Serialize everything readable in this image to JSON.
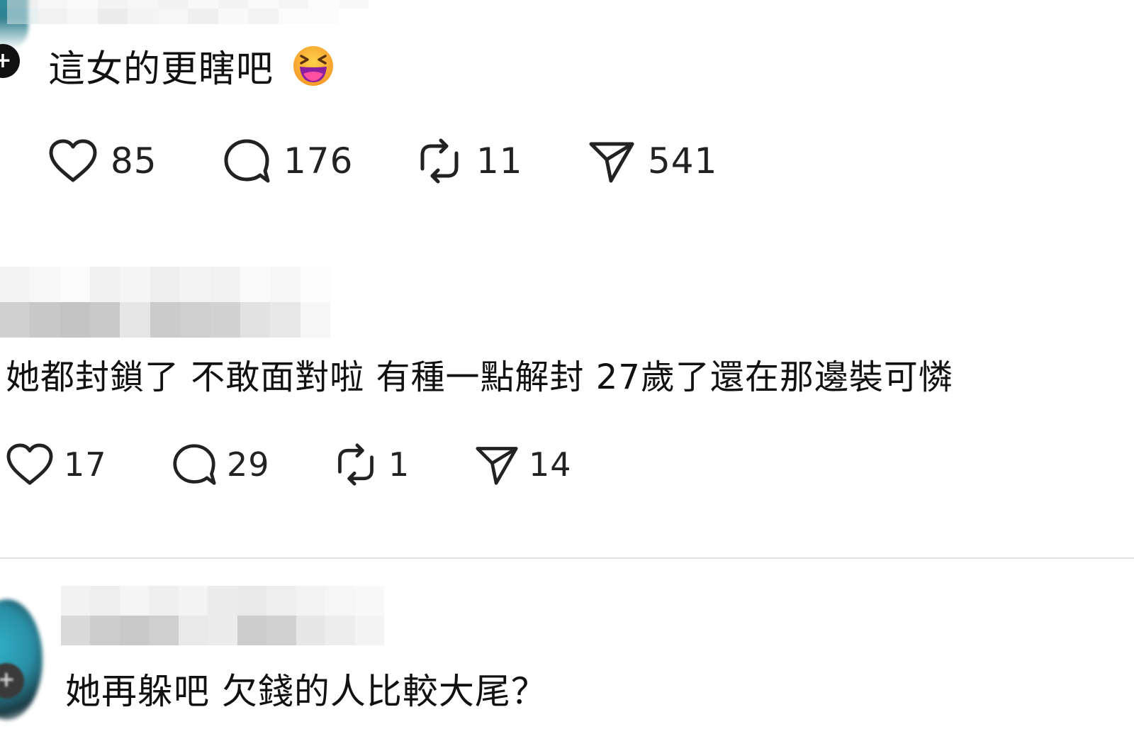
{
  "posts": [
    {
      "username": "",
      "text": "這女的更瞎吧",
      "emoji": "grinning-squinting-face",
      "likes": "85",
      "replies": "176",
      "reposts": "11",
      "shares": "541"
    },
    {
      "username": "",
      "text": "她都封鎖了 不敢面對啦 有種一點解封 27歲了還在那邊裝可憐",
      "likes": "17",
      "replies": "29",
      "reposts": "1",
      "shares": "14"
    },
    {
      "username": "",
      "text": "她再躲吧 欠錢的人比較大尾？"
    }
  ],
  "icons": {
    "like": "heart-icon",
    "reply": "comment-bubble-icon",
    "repost": "repost-icon",
    "share": "send-icon",
    "follow": "plus-icon"
  },
  "colors": {
    "text": "#111111",
    "icon": "#222222",
    "divider": "#e0e0e0",
    "avatar_accent": "#2aa1b0"
  }
}
